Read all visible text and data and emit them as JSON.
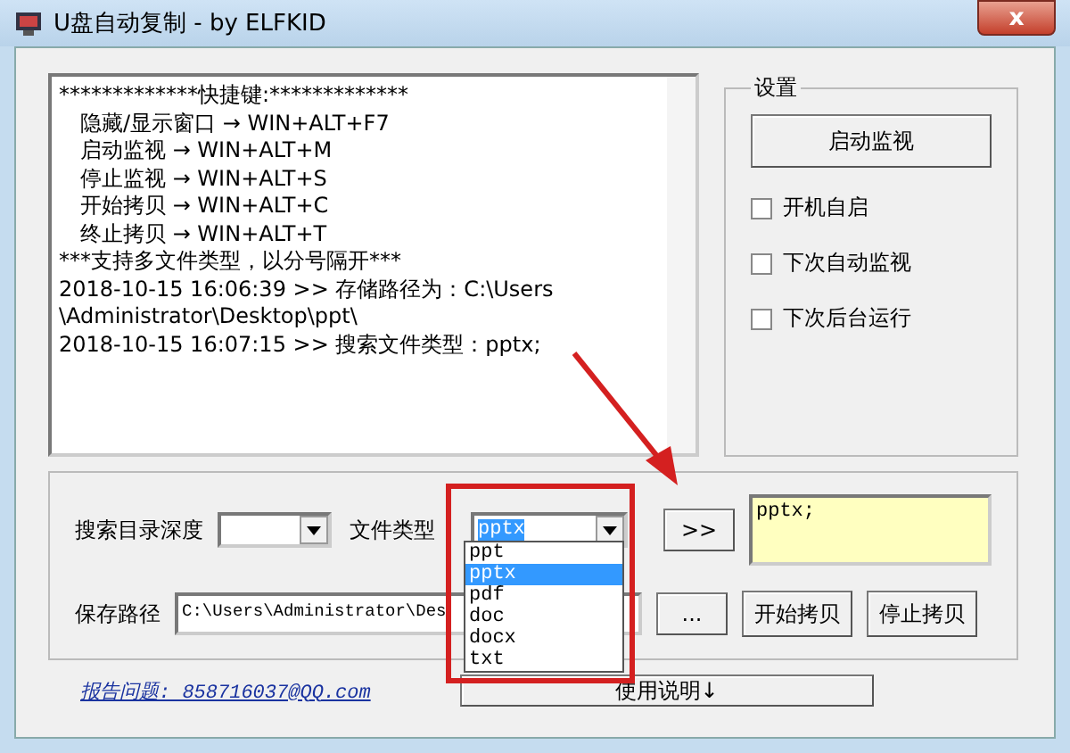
{
  "window": {
    "title": "U盘自动复制 - by ELFKID",
    "close": "x"
  },
  "log": [
    {
      "kind": "plain",
      "text": "*************快捷键:*************"
    },
    {
      "kind": "shortcut",
      "text": "隐藏/显示窗口 → WIN+ALT+F7"
    },
    {
      "kind": "shortcut",
      "text": "启动监视 → WIN+ALT+M"
    },
    {
      "kind": "shortcut",
      "text": "停止监视 → WIN+ALT+S"
    },
    {
      "kind": "shortcut",
      "text": "开始拷贝 → WIN+ALT+C"
    },
    {
      "kind": "shortcut",
      "text": "终止拷贝 → WIN+ALT+T"
    },
    {
      "kind": "plain",
      "text": "***支持多文件类型，以分号隔开***"
    },
    {
      "kind": "plain",
      "text": "2018-10-15 16:06:39 >> 存储路径为：C:\\Users"
    },
    {
      "kind": "plain",
      "text": "\\Administrator\\Desktop\\ppt\\"
    },
    {
      "kind": "plain",
      "text": "2018-10-15 16:07:15 >> 搜索文件类型：pptx;"
    }
  ],
  "settings": {
    "title": "设置",
    "button": "启动监视",
    "checkboxes": [
      {
        "label": "开机自启",
        "checked": false
      },
      {
        "label": "下次自动监视",
        "checked": false
      },
      {
        "label": "下次后台运行",
        "checked": false
      }
    ]
  },
  "search": {
    "depth_label": "搜索目录深度",
    "type_label": "文件类型",
    "type_value": "pptx",
    "add_button": ">>",
    "types_box": "pptx;",
    "options": [
      {
        "label": "ppt",
        "selected": false
      },
      {
        "label": "pptx",
        "selected": true
      },
      {
        "label": "pdf",
        "selected": false
      },
      {
        "label": "doc",
        "selected": false
      },
      {
        "label": "docx",
        "selected": false
      },
      {
        "label": "txt",
        "selected": false
      }
    ]
  },
  "save": {
    "label": "保存路径",
    "value": "C:\\Users\\Administrator\\Des",
    "browse_button": "...",
    "start_button": "开始拷贝",
    "stop_button": "停止拷贝"
  },
  "footer": {
    "link": "报告问题: 858716037@QQ.com",
    "help_button": "使用说明↓"
  }
}
